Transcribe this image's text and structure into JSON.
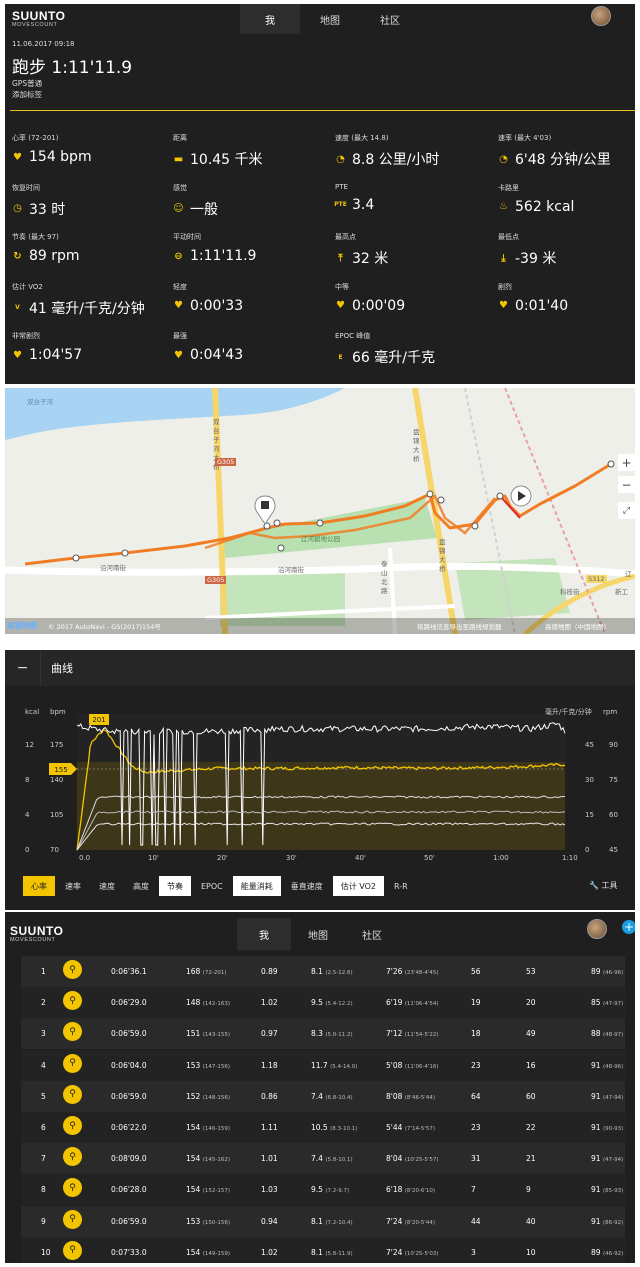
{
  "app": {
    "logo": "SUUNTO",
    "logo_sub": "MOVESCOUNT",
    "nav": [
      "我",
      "地图",
      "社区"
    ]
  },
  "activity": {
    "date": "11.06.2017 09:18",
    "title": "跑步 1:11'11.9",
    "gps": "GPS普通",
    "add_tag": "添加标签"
  },
  "stats": [
    {
      "label": "心率 (72-201)",
      "value": "154 bpm",
      "icon": "heart-icon"
    },
    {
      "label": "距离",
      "value": "10.45 千米",
      "icon": "ruler-icon"
    },
    {
      "label": "速度 (最大 14.8)",
      "value": "8.8 公里/小时",
      "icon": "speedometer-icon"
    },
    {
      "label": "速率 (最大 4'03)",
      "value": "6'48 分钟/公里",
      "icon": "speedometer-icon"
    },
    {
      "label": "恢复时间",
      "value": "33 时",
      "icon": "clock-icon"
    },
    {
      "label": "感觉",
      "value": "一般",
      "icon": "smiley-icon"
    },
    {
      "label": "PTE",
      "value": "3.4",
      "icon": "pte-icon"
    },
    {
      "label": "卡路里",
      "value": "562 kcal",
      "icon": "flame-icon"
    },
    {
      "label": "节奏 (最大 97)",
      "value": "89 rpm",
      "icon": "cadence-icon"
    },
    {
      "label": "平动时间",
      "value": "1:11'11.9",
      "icon": "timer-icon"
    },
    {
      "label": "最高点",
      "value": "32 米",
      "icon": "arrow-up-icon"
    },
    {
      "label": "最低点",
      "value": "-39 米",
      "icon": "arrow-down-icon"
    },
    {
      "label": "估计 VO2",
      "value": "41 毫升/千克/分钟",
      "icon": "vo2-icon"
    },
    {
      "label": "轻度",
      "value": "0:00'33",
      "icon": "heart-zone-icon"
    },
    {
      "label": "中等",
      "value": "0:00'09",
      "icon": "heart-zone-icon"
    },
    {
      "label": "剧烈",
      "value": "0:01'40",
      "icon": "heart-zone-icon"
    },
    {
      "label": "非常剧烈",
      "value": "1:04'57",
      "icon": "heart-zone-icon"
    },
    {
      "label": "最强",
      "value": "0:04'43",
      "icon": "heart-zone-icon"
    },
    {
      "label": "EPOC 峰值",
      "value": "66 毫升/千克",
      "icon": "epoc-icon"
    }
  ],
  "map": {
    "labels": {
      "river_village": "双台子河",
      "bridge_left": "双台子河大桥",
      "bridge_right": "盘锦大桥",
      "road_g305_a": "G305",
      "road_g305_b": "G305",
      "park": "辽河碧地公园",
      "street": "沿河南街",
      "street_b": "沿河南街",
      "road_taishan": "泰山北路",
      "road_panjin": "盘锦大桥",
      "road_s": "S312",
      "road_keji": "科技街",
      "road_liao": "辽",
      "road_xin": "新工"
    },
    "zoom_in": "+",
    "zoom_out": "−",
    "logo": "高德地图",
    "copyright": "© 2017 AutoNavi - GS(2017)154号",
    "note": "将路线信息导出至路线规划器",
    "source": "高德地图（中国地图）"
  },
  "curve": {
    "collapse": "−",
    "title": "曲线",
    "chips": [
      {
        "label": "心率",
        "style": "yellow"
      },
      {
        "label": "速率",
        "style": ""
      },
      {
        "label": "速度",
        "style": ""
      },
      {
        "label": "高度",
        "style": ""
      },
      {
        "label": "节奏",
        "style": "white"
      },
      {
        "label": "EPOC",
        "style": ""
      },
      {
        "label": "能量消耗",
        "style": "white"
      },
      {
        "label": "垂直速度",
        "style": ""
      },
      {
        "label": "估计 VO2",
        "style": "white"
      },
      {
        "label": "R-R",
        "style": ""
      }
    ],
    "tools": "工具"
  },
  "chart_data": {
    "type": "line",
    "x_ticks": [
      "0.0",
      "10'",
      "20'",
      "30'",
      "40'",
      "50'",
      "1:00",
      "1:10"
    ],
    "left_axis_kcal": {
      "label": "kcal",
      "ticks": [
        "12",
        "8",
        "4",
        "0"
      ]
    },
    "left_axis_bpm": {
      "label": "bpm",
      "ticks": [
        "175",
        "140",
        "105",
        "70"
      ]
    },
    "right_axis_pace": {
      "label": "毫升/千克/分钟",
      "ticks": [
        "45",
        "30",
        "15",
        "0"
      ]
    },
    "right_axis_rpm": {
      "label": "rpm",
      "ticks": [
        "90",
        "75",
        "60",
        "45"
      ]
    },
    "hr_max_label": "201",
    "hr_avg_label": "155",
    "series": [
      {
        "color": "#f2c500",
        "x": [
          0,
          2,
          4,
          6,
          8,
          10,
          15,
          20,
          30,
          40,
          50,
          60,
          65,
          68,
          71
        ],
        "values": [
          70,
          180,
          195,
          175,
          156,
          150,
          152,
          154,
          154,
          155,
          154,
          155,
          156,
          157,
          158
        ]
      },
      {
        "color": "#ffffff",
        "x": [
          0,
          5,
          10,
          20,
          30,
          40,
          50,
          60,
          66,
          70,
          71
        ],
        "values": [
          90,
          88,
          88,
          88,
          89,
          89,
          89,
          90,
          89,
          91,
          88
        ]
      }
    ]
  },
  "laps": {
    "rows": [
      {
        "n": "1",
        "dur": "0:06'36.1",
        "hr": "168",
        "hr_r": "(72-201)",
        "pte": "0.89",
        "spd": "8.1",
        "spd_r": "(2.5-12.6)",
        "pace": "7'26",
        "pace_r": "(23'48-4'45)",
        "a": "56",
        "b": "53",
        "cad": "89",
        "cad_r": "(46-96)"
      },
      {
        "n": "2",
        "dur": "0:06'29.0",
        "hr": "148",
        "hr_r": "(142-163)",
        "pte": "1.02",
        "spd": "9.5",
        "spd_r": "(5.4-12.2)",
        "pace": "6'19",
        "pace_r": "(11'06-4'54)",
        "a": "19",
        "b": "20",
        "cad": "85",
        "cad_r": "(47-97)"
      },
      {
        "n": "3",
        "dur": "0:06'59.0",
        "hr": "151",
        "hr_r": "(143-155)",
        "pte": "0.97",
        "spd": "8.3",
        "spd_r": "(5.0-11.2)",
        "pace": "7'12",
        "pace_r": "(11'54-5'22)",
        "a": "18",
        "b": "49",
        "cad": "88",
        "cad_r": "(48-97)"
      },
      {
        "n": "4",
        "dur": "0:06'04.0",
        "hr": "153",
        "hr_r": "(147-156)",
        "pte": "1.18",
        "spd": "11.7",
        "spd_r": "(5.4-14.0)",
        "pace": "5'08",
        "pace_r": "(11'06-4'16)",
        "a": "23",
        "b": "16",
        "cad": "91",
        "cad_r": "(48-96)"
      },
      {
        "n": "5",
        "dur": "0:06'59.0",
        "hr": "152",
        "hr_r": "(148-156)",
        "pte": "0.86",
        "spd": "7.4",
        "spd_r": "(6.8-10.4)",
        "pace": "8'08",
        "pace_r": "(8'46-5'44)",
        "a": "64",
        "b": "60",
        "cad": "91",
        "cad_r": "(47-94)"
      },
      {
        "n": "6",
        "dur": "0:06'22.0",
        "hr": "154",
        "hr_r": "(146-159)",
        "pte": "1.11",
        "spd": "10.5",
        "spd_r": "(8.3-10.1)",
        "pace": "5'44",
        "pace_r": "(7'14-5'57)",
        "a": "23",
        "b": "22",
        "cad": "91",
        "cad_r": "(90-93)"
      },
      {
        "n": "7",
        "dur": "0:08'09.0",
        "hr": "154",
        "hr_r": "(145-162)",
        "pte": "1.01",
        "spd": "7.4",
        "spd_r": "(5.8-10.1)",
        "pace": "8'04",
        "pace_r": "(10'25-5'57)",
        "a": "31",
        "b": "21",
        "cad": "91",
        "cad_r": "(47-94)"
      },
      {
        "n": "8",
        "dur": "0:06'28.0",
        "hr": "154",
        "hr_r": "(152-157)",
        "pte": "1.03",
        "spd": "9.5",
        "spd_r": "(7.2-9.7)",
        "pace": "6'18",
        "pace_r": "(8'20-6'10)",
        "a": "7",
        "b": "9",
        "cad": "91",
        "cad_r": "(85-93)"
      },
      {
        "n": "9",
        "dur": "0:06'59.0",
        "hr": "153",
        "hr_r": "(150-156)",
        "pte": "0.94",
        "spd": "8.1",
        "spd_r": "(7.2-10.4)",
        "pace": "7'24",
        "pace_r": "(8'20-5'44)",
        "a": "44",
        "b": "40",
        "cad": "91",
        "cad_r": "(86-92)"
      },
      {
        "n": "10",
        "dur": "0:07'33.0",
        "hr": "154",
        "hr_r": "(149-159)",
        "pte": "1.02",
        "spd": "8.1",
        "spd_r": "(5.8-11.9)",
        "pace": "7'24",
        "pace_r": "(10'25-5'03)",
        "a": "3",
        "b": "10",
        "cad": "89",
        "cad_r": "(46-92)"
      }
    ],
    "plus": "+"
  }
}
